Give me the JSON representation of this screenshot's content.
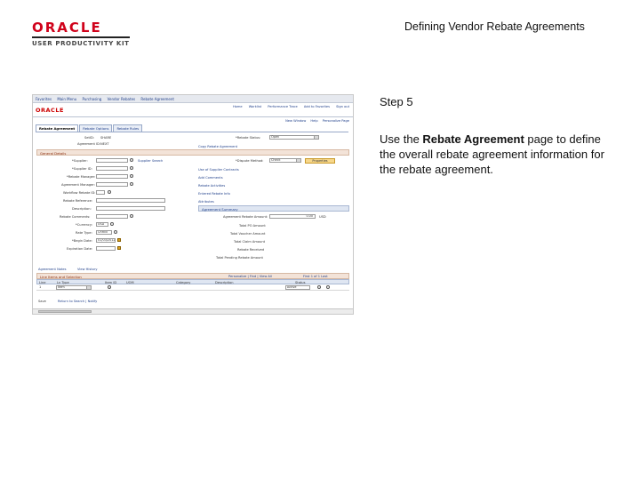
{
  "header": {
    "logo_brand": "ORACLE",
    "logo_product": "USER PRODUCTIVITY KIT",
    "title": "Defining Vendor Rebate Agreements"
  },
  "step": {
    "label": "Step 5"
  },
  "instruction": {
    "before": "Use the ",
    "bold": "Rebate Agreement",
    "after": " page to define the overall rebate agreement information for the rebate agreement."
  },
  "screenshot": {
    "topnav": [
      "Favorites",
      "Main Menu",
      "Purchasing",
      "Vendor Rebates",
      "Rebate Agreement"
    ],
    "app_logo": "ORACLE",
    "app_links": [
      "Home",
      "Worklist",
      "Performance Trace",
      "Add to Favorites",
      "Sign out"
    ],
    "help_links": [
      "New Window",
      "Help",
      "Personalize Page"
    ],
    "tabs": [
      "Rebate Agreement",
      "Rebate Options",
      "Rebate Rules"
    ],
    "fields_left": [
      {
        "label": "SetID:",
        "value": "SHARE"
      },
      {
        "label": "Agreement ID:",
        "value": "NEXT"
      },
      {
        "label": "General Details",
        "value": ""
      },
      {
        "label": "*Supplier:",
        "value": ""
      },
      {
        "label": "*Supplier ID:",
        "value": ""
      },
      {
        "label": "*Rebate Manager:",
        "value": ""
      },
      {
        "label": "Agreement Manager:",
        "value": ""
      },
      {
        "label": "Workflow Rebate ID:",
        "value": ""
      },
      {
        "label": "Rebate Reference:",
        "value": ""
      },
      {
        "label": "Description:",
        "value": ""
      },
      {
        "label": "Rebate Comments:",
        "value": ""
      },
      {
        "label": "*Currency:",
        "value": "USD"
      },
      {
        "label": "Rate Type:",
        "value": "CRRNT"
      },
      {
        "label": "*Begin Date:",
        "value": "01/03/2012"
      },
      {
        "label": "Expiration Date:",
        "value": ""
      }
    ],
    "supplier_search": "Supplier Search",
    "fields_right": [
      {
        "label": "*Rebate Status:",
        "value": "Open"
      },
      {
        "label": "Copy Rebate Agreement",
        "value": ""
      },
      {
        "label": "*Dispute Method:",
        "value": "Check"
      },
      {
        "label": "Use of Supplier Contracts",
        "value": ""
      },
      {
        "label": "Add Comments",
        "value": ""
      },
      {
        "label": "Rebate Activities",
        "value": ""
      },
      {
        "label": "Entered Rebate Info",
        "value": ""
      },
      {
        "label": "Attributes",
        "value": ""
      }
    ],
    "properties_button": "Properties",
    "summary_section": "Agreement Summary",
    "summary_fields": [
      {
        "label": "Agreement Rebate Amount:",
        "value": "0.00"
      },
      {
        "label": "Total PO Amount",
        "value": ""
      },
      {
        "label": "Total Voucher Amount",
        "value": ""
      },
      {
        "label": "Total Claim Amount",
        "value": ""
      },
      {
        "label": "Rebate Received",
        "value": ""
      },
      {
        "label": "Total Pending Rebate Amount",
        "value": ""
      }
    ],
    "summary_currency": "USD",
    "agreement_notes": "Agreement Notes",
    "view_history": "View History",
    "grid_section": "Line Items and Selection",
    "grid_nav": "Personalize | Find | View All",
    "grid_pager": "First  1 of 1  Last",
    "grid_columns": [
      "Line",
      "Ln Type",
      "Item ID",
      "UOM",
      "Category",
      "Description",
      "Status"
    ],
    "grid_row": {
      "line": "1",
      "ln_type": "Item",
      "status": "Active"
    },
    "footer_save": "Save",
    "footer_link": "Return to Search  |  Notify"
  }
}
